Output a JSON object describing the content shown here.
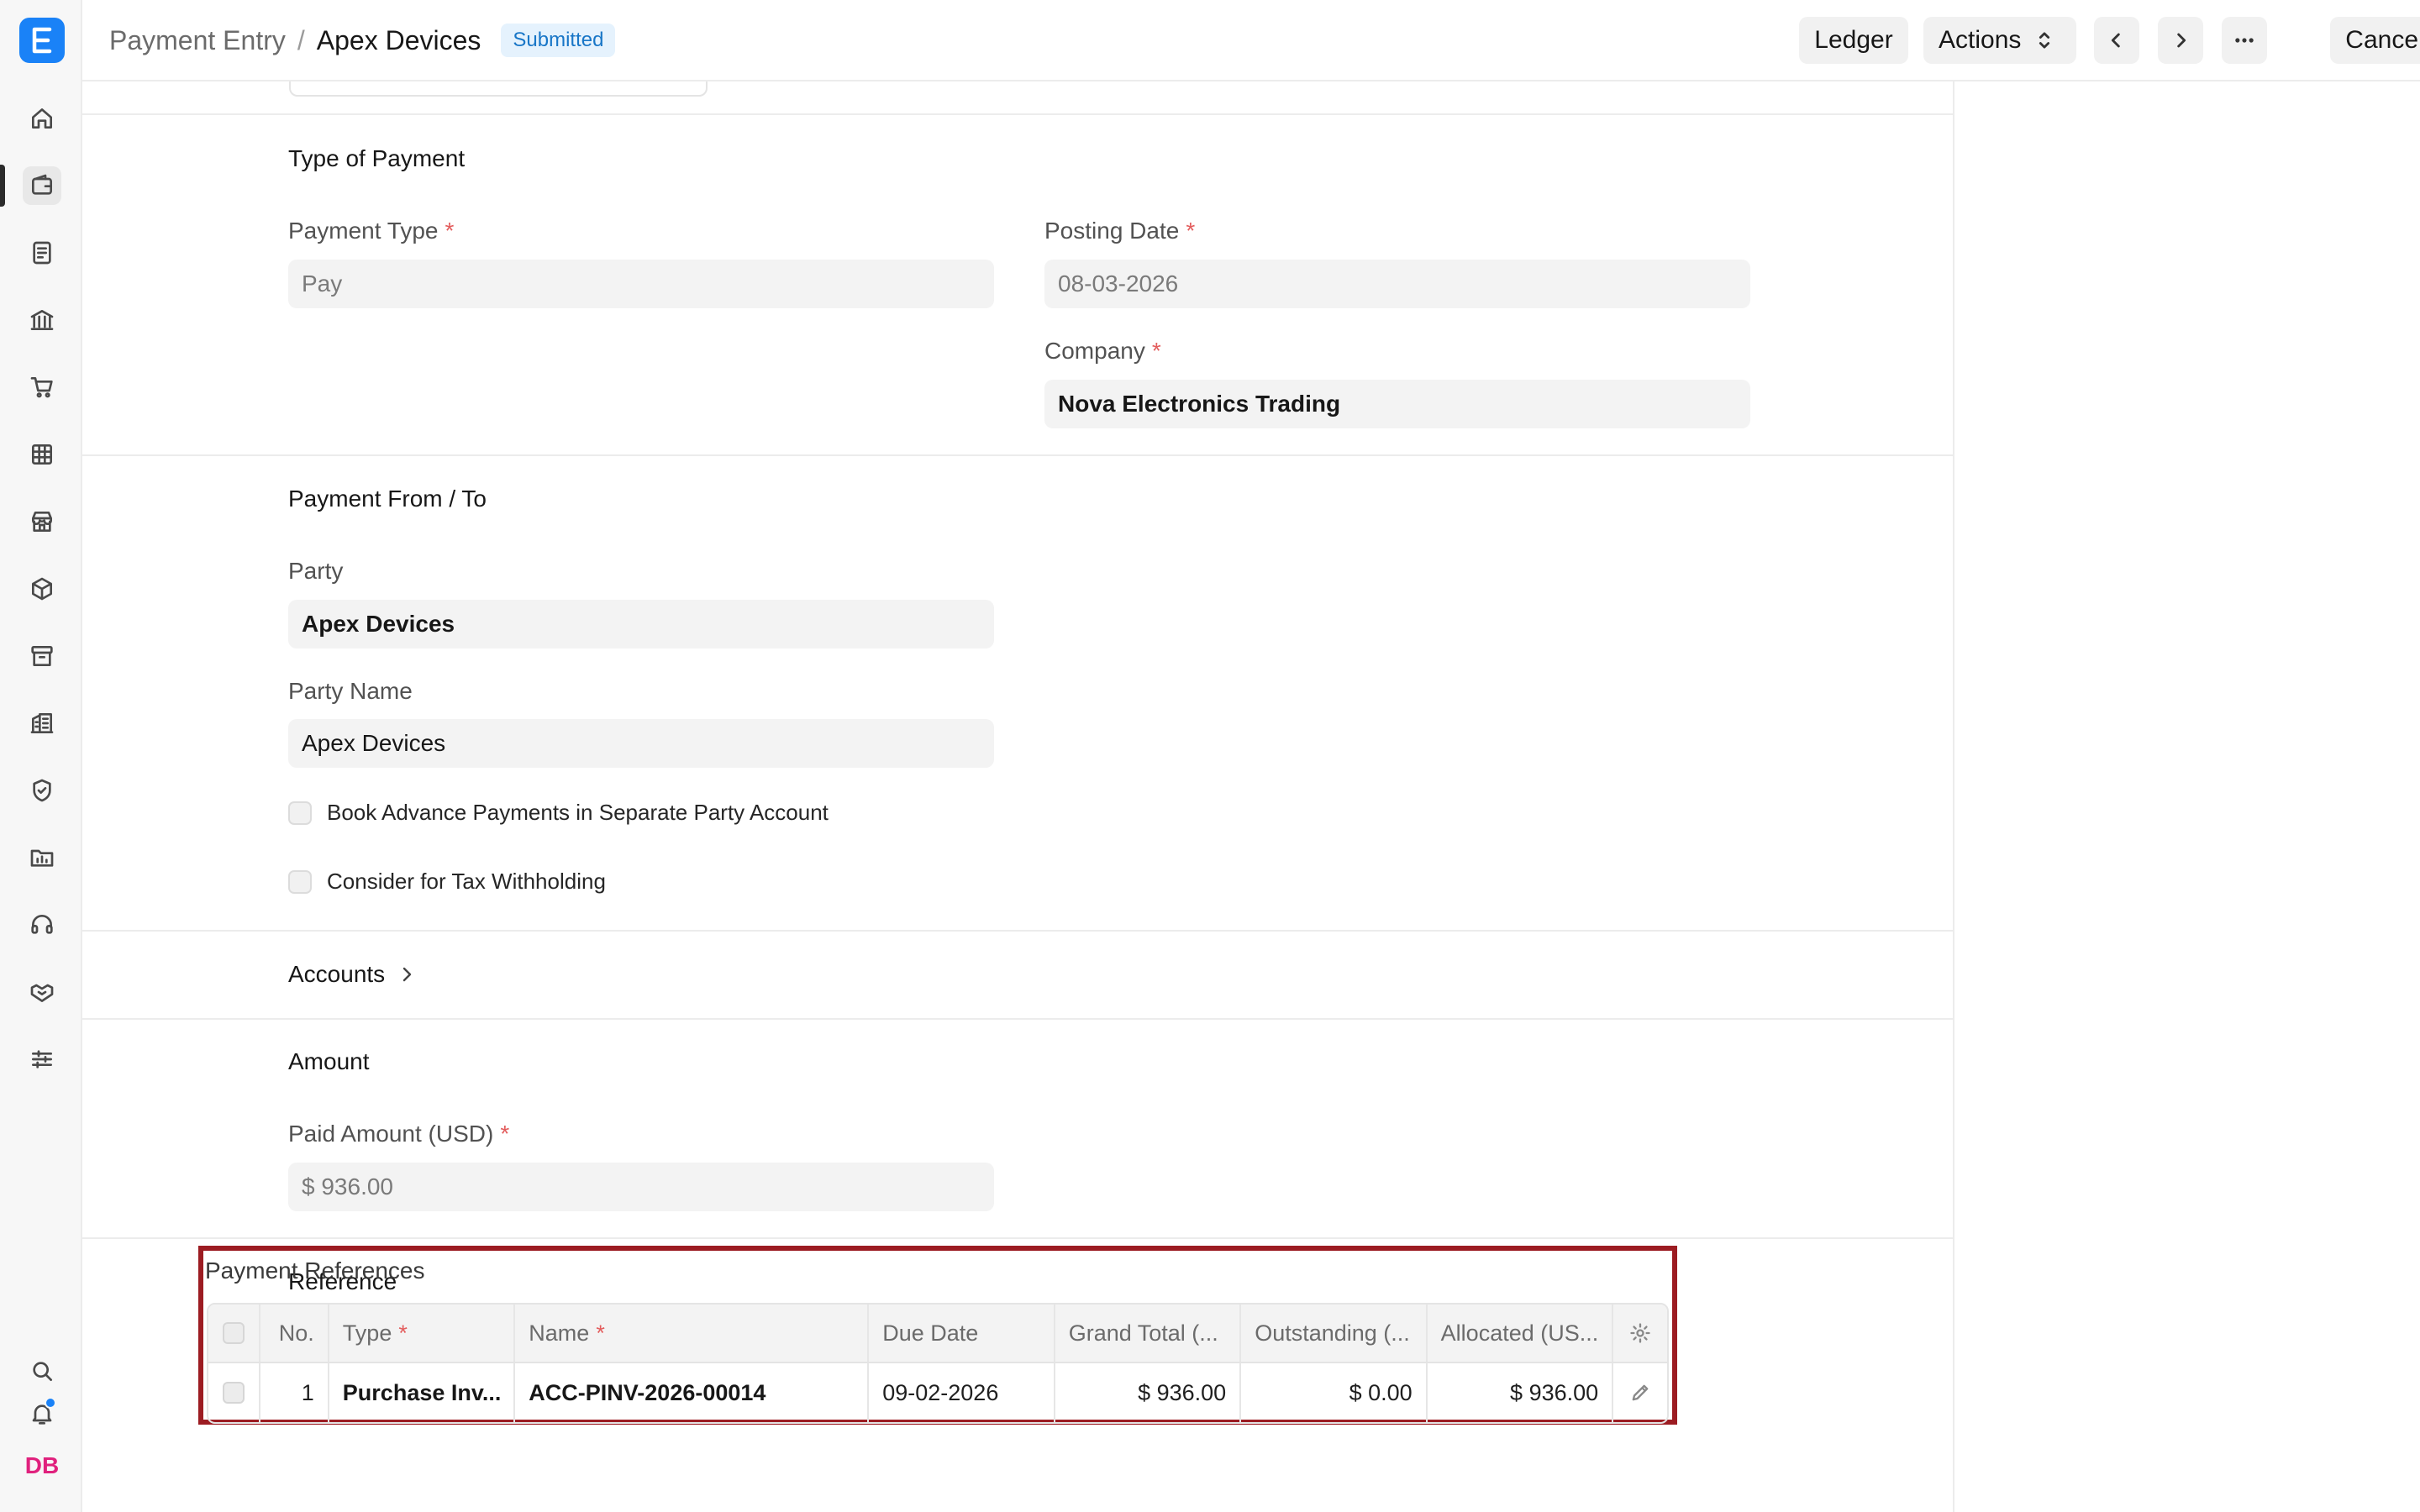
{
  "sidebar": {
    "icons": [
      "home-icon",
      "wallet-icon",
      "document-icon",
      "bank-icon",
      "cart-icon",
      "table-icon",
      "store-icon",
      "box-icon",
      "archive-icon",
      "building-icon",
      "shield-icon",
      "folder-chart-icon",
      "headset-icon",
      "handshake-icon",
      "sliders-icon"
    ],
    "bottom_icons": [
      "search-icon",
      "bell-icon"
    ],
    "avatar": "DB"
  },
  "header": {
    "breadcrumb_parent": "Payment Entry",
    "breadcrumb_separator": "/",
    "title": "Apex Devices",
    "status": "Submitted",
    "ledger_label": "Ledger",
    "actions_label": "Actions",
    "cancel_label": "Cancel"
  },
  "type_of_payment": {
    "title": "Type of Payment",
    "payment_type_label": "Payment Type",
    "payment_type_value": "Pay",
    "posting_date_label": "Posting Date",
    "posting_date_value": "08-03-2026",
    "company_label": "Company",
    "company_value": "Nova Electronics Trading",
    "required_mark": "*"
  },
  "payment_from_to": {
    "title": "Payment From / To",
    "party_label": "Party",
    "party_value": "Apex Devices",
    "party_name_label": "Party Name",
    "party_name_value": "Apex Devices",
    "advance_label": "Book Advance Payments in Separate Party Account",
    "tax_label": "Consider for Tax Withholding"
  },
  "accounts": {
    "title": "Accounts"
  },
  "amount": {
    "title": "Amount",
    "paid_amount_label": "Paid Amount (USD)",
    "paid_amount_value": "$ 936.00"
  },
  "reference": {
    "title": "Reference",
    "table_label": "Payment References",
    "columns": [
      "No.",
      "Type",
      "Name",
      "Due Date",
      "Grand Total (...",
      "Outstanding (...",
      "Allocated (US..."
    ],
    "rows": [
      {
        "no": "1",
        "type": "Purchase Inv...",
        "name": "ACC-PINV-2026-00014",
        "due_date": "09-02-2026",
        "grand_total": "$ 936.00",
        "outstanding": "$ 0.00",
        "allocated": "$ 936.00"
      }
    ]
  },
  "colors": {
    "accent": "#1a82f7",
    "highlight_border": "#9c1c22",
    "badge_bg": "#e5f2fd",
    "badge_text": "#1876c7",
    "avatar": "#e0217d"
  }
}
